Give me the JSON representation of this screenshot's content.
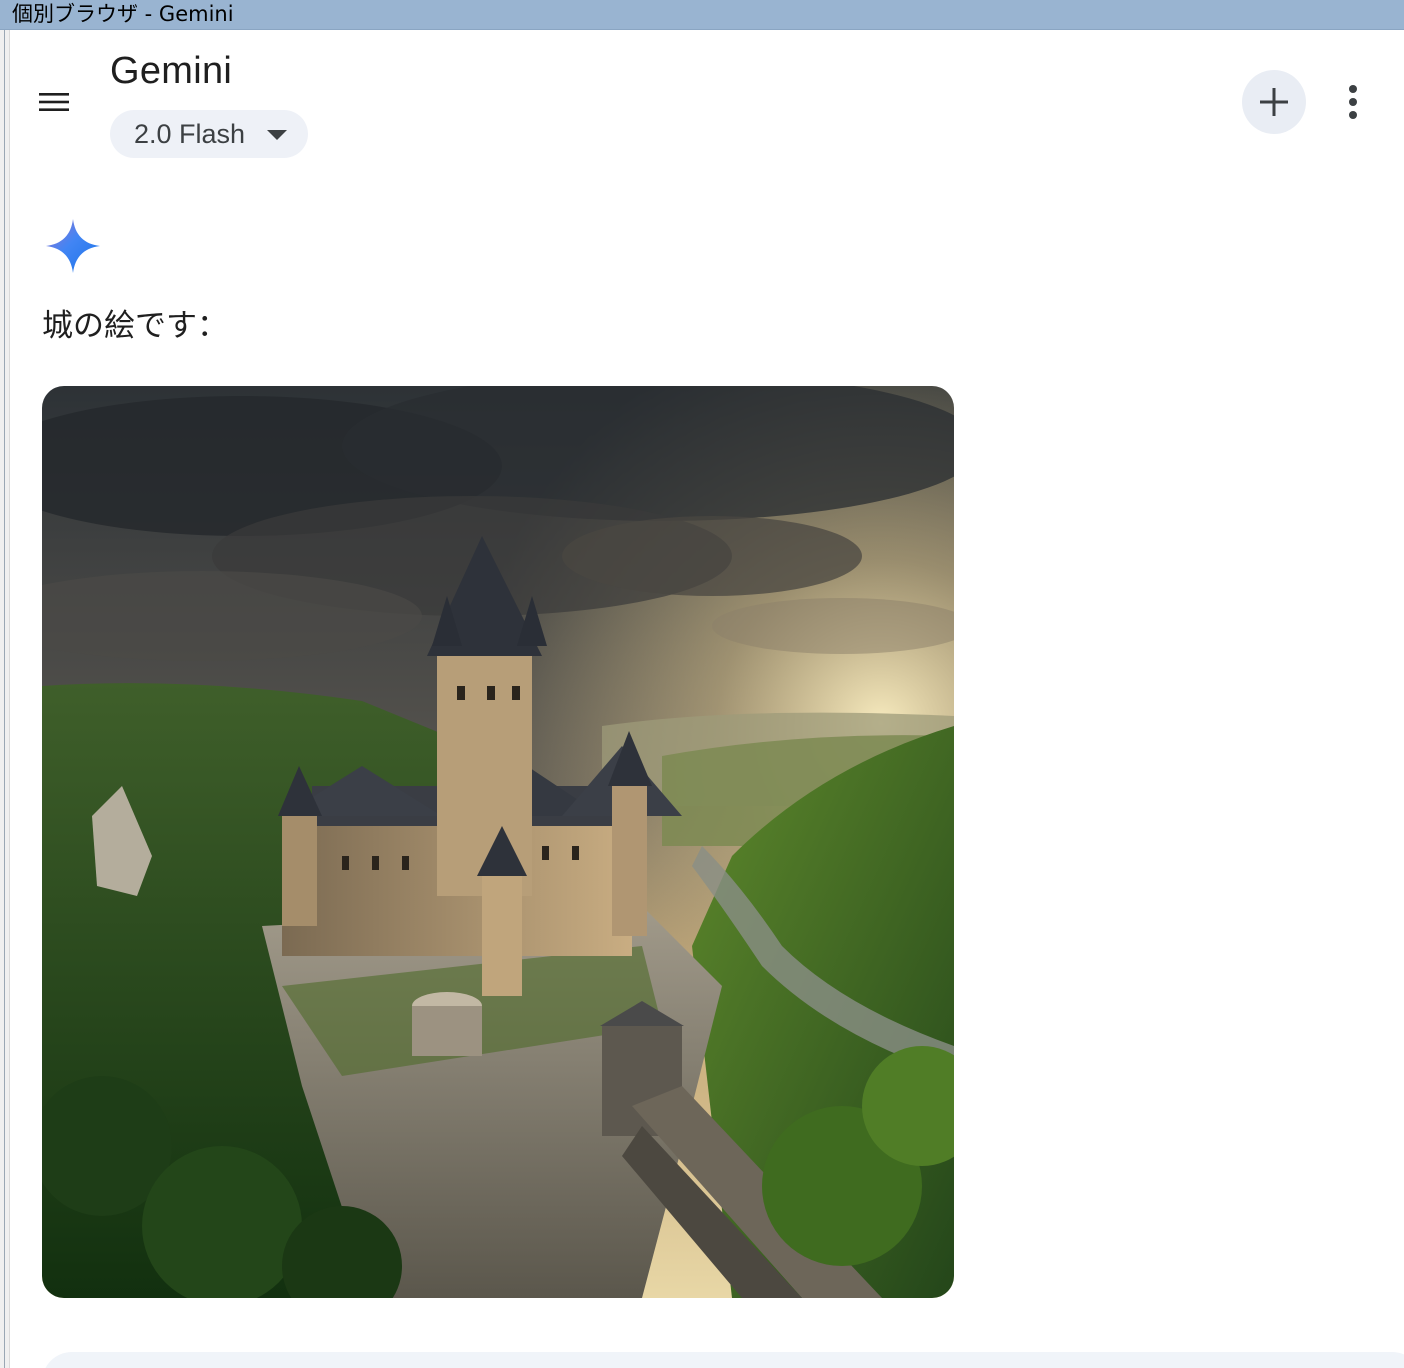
{
  "window": {
    "title": "個別ブラウザ - Gemini"
  },
  "header": {
    "app_title": "Gemini",
    "model_selector": {
      "label": "2.0 Flash",
      "icon": "caret-down-icon"
    },
    "menu_icon": "hamburger-menu-icon",
    "new_chat_icon": "plus-icon",
    "more_icon": "vertical-dots-icon"
  },
  "response": {
    "avatar_icon": "gemini-spark-icon",
    "text": "城の絵です：",
    "image_subject": "castle-on-cliff-above-river-valley"
  },
  "colors": {
    "titlebar": "#99b4d1",
    "chip_background": "#eef1f7",
    "new_chat_background": "#e9edf4",
    "spark_blue": "#4285f4",
    "prompt_bar": "#f0f4f9"
  }
}
